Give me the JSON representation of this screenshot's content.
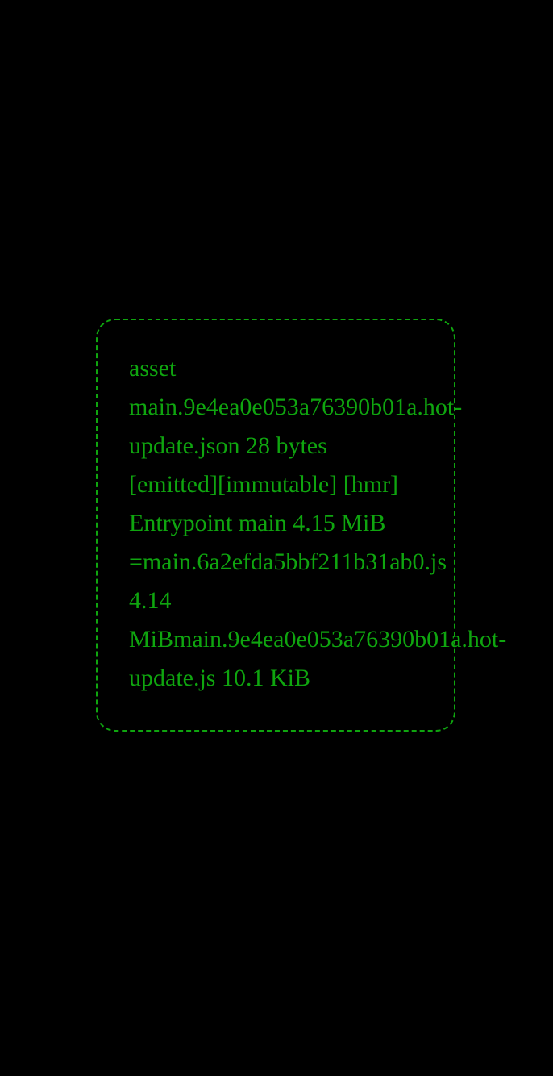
{
  "colors": {
    "background": "#000000",
    "terminal_green": "#0fa50f"
  },
  "log": {
    "lines": [
      "asset",
      "main.9e4ea0e053a76390b01a.hot-",
      "update.json 28 bytes",
      "[emitted][immutable] [hmr]",
      "Entrypoint main 4.15 MiB",
      "=main.6a2efda5bbf211b31ab0.js",
      "4.14",
      "MiBmain.9e4ea0e053a76390b01a.hot-",
      "update.js 10.1 KiB"
    ]
  }
}
